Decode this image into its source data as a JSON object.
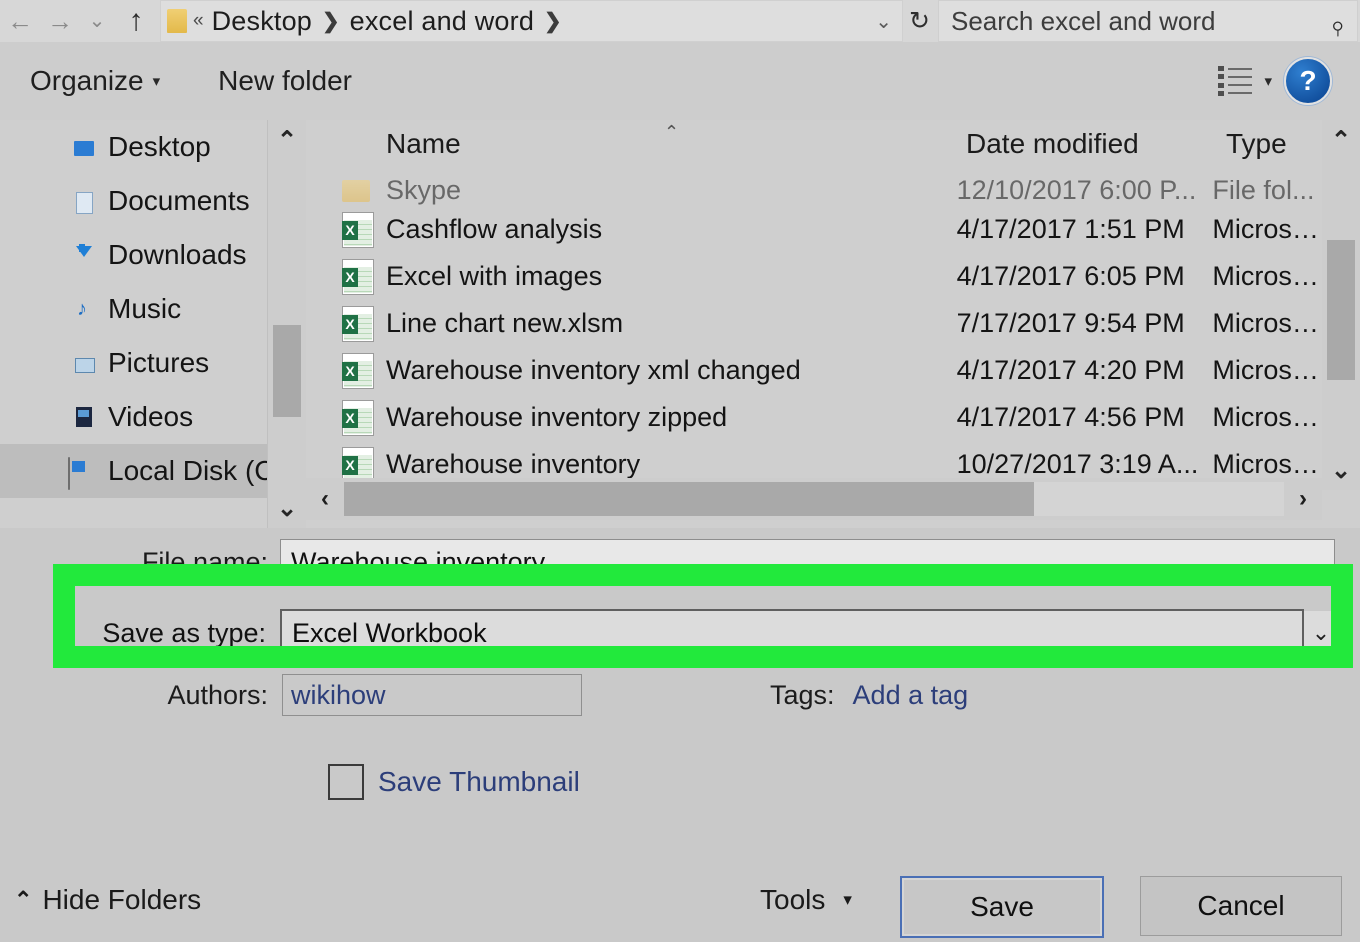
{
  "addressbar": {
    "back_icon": "back-arrow-icon",
    "forward_icon": "forward-arrow-icon",
    "recent_icon": "chevron-down-icon",
    "up_icon": "up-arrow-icon",
    "sep_double": "«",
    "crumbs": [
      "Desktop",
      "excel and word"
    ],
    "crumb_sep": "❯",
    "dropdown_caret": "⌄",
    "refresh_icon": "↻",
    "search_placeholder": "Search excel and word",
    "search_icon": "⌕"
  },
  "commandbar": {
    "organize_label": "Organize",
    "organize_caret": "▾",
    "new_folder_label": "New folder",
    "view_icon": "list-view-icon",
    "view_caret": "▾",
    "help_label": "?"
  },
  "sidebar": {
    "scroll_up": "⌃",
    "scroll_down": "⌄",
    "items": [
      {
        "label": "Desktop",
        "icon": "folder-desktop-icon",
        "selected": false
      },
      {
        "label": "Documents",
        "icon": "folder-documents-icon",
        "selected": false
      },
      {
        "label": "Downloads",
        "icon": "folder-downloads-icon",
        "selected": false
      },
      {
        "label": "Music",
        "icon": "folder-music-icon",
        "selected": false
      },
      {
        "label": "Pictures",
        "icon": "folder-pictures-icon",
        "selected": false
      },
      {
        "label": "Videos",
        "icon": "folder-videos-icon",
        "selected": false
      },
      {
        "label": "Local Disk (C:)",
        "icon": "local-disk-icon",
        "selected": true
      }
    ]
  },
  "filelist": {
    "columns": [
      "Name",
      "Date modified",
      "Type"
    ],
    "sort_indicator": "⌃",
    "rows": [
      {
        "name": "Skype",
        "date": "12/10/2017 6:00 P...",
        "type": "File fol...",
        "icon": "folder-icon",
        "clipped": true
      },
      {
        "name": "Cashflow analysis",
        "date": "4/17/2017 1:51 PM",
        "type": "Micros…",
        "icon": "excel-file-icon",
        "clipped": false
      },
      {
        "name": "Excel with images",
        "date": "4/17/2017 6:05 PM",
        "type": "Micros…",
        "icon": "excel-file-icon",
        "clipped": false
      },
      {
        "name": "Line chart new.xlsm",
        "date": "7/17/2017 9:54 PM",
        "type": "Micros…",
        "icon": "excel-file-icon",
        "clipped": false
      },
      {
        "name": "Warehouse inventory xml changed",
        "date": "4/17/2017 4:20 PM",
        "type": "Micros…",
        "icon": "excel-file-icon",
        "clipped": false
      },
      {
        "name": "Warehouse inventory zipped",
        "date": "4/17/2017 4:56 PM",
        "type": "Micros…",
        "icon": "excel-file-icon",
        "clipped": false
      },
      {
        "name": "Warehouse inventory",
        "date": "10/27/2017 3:19 A...",
        "type": "Micros…",
        "icon": "excel-file-icon",
        "clipped": false
      }
    ],
    "scroll_up": "⌃",
    "scroll_down": "⌄",
    "hscroll_left": "‹",
    "hscroll_right": "›"
  },
  "form": {
    "filename_label": "File name:",
    "filename_value": "Warehouse inventory",
    "save_as_type_label": "Save as type:",
    "save_as_type_value": "Excel Workbook",
    "save_as_type_caret": "⌄",
    "authors_label": "Authors:",
    "authors_value": "wikihow",
    "tags_label": "Tags:",
    "tags_value": "Add a tag",
    "save_thumbnail_label": "Save Thumbnail",
    "save_thumbnail_checked": false
  },
  "footer": {
    "hide_folders_caret": "⌃",
    "hide_folders_label": "Hide Folders",
    "tools_label": "Tools",
    "tools_caret": "▾",
    "save_label": "Save",
    "cancel_label": "Cancel"
  },
  "highlight": {
    "color": "#22e93c",
    "target": "save-as-type-row"
  }
}
